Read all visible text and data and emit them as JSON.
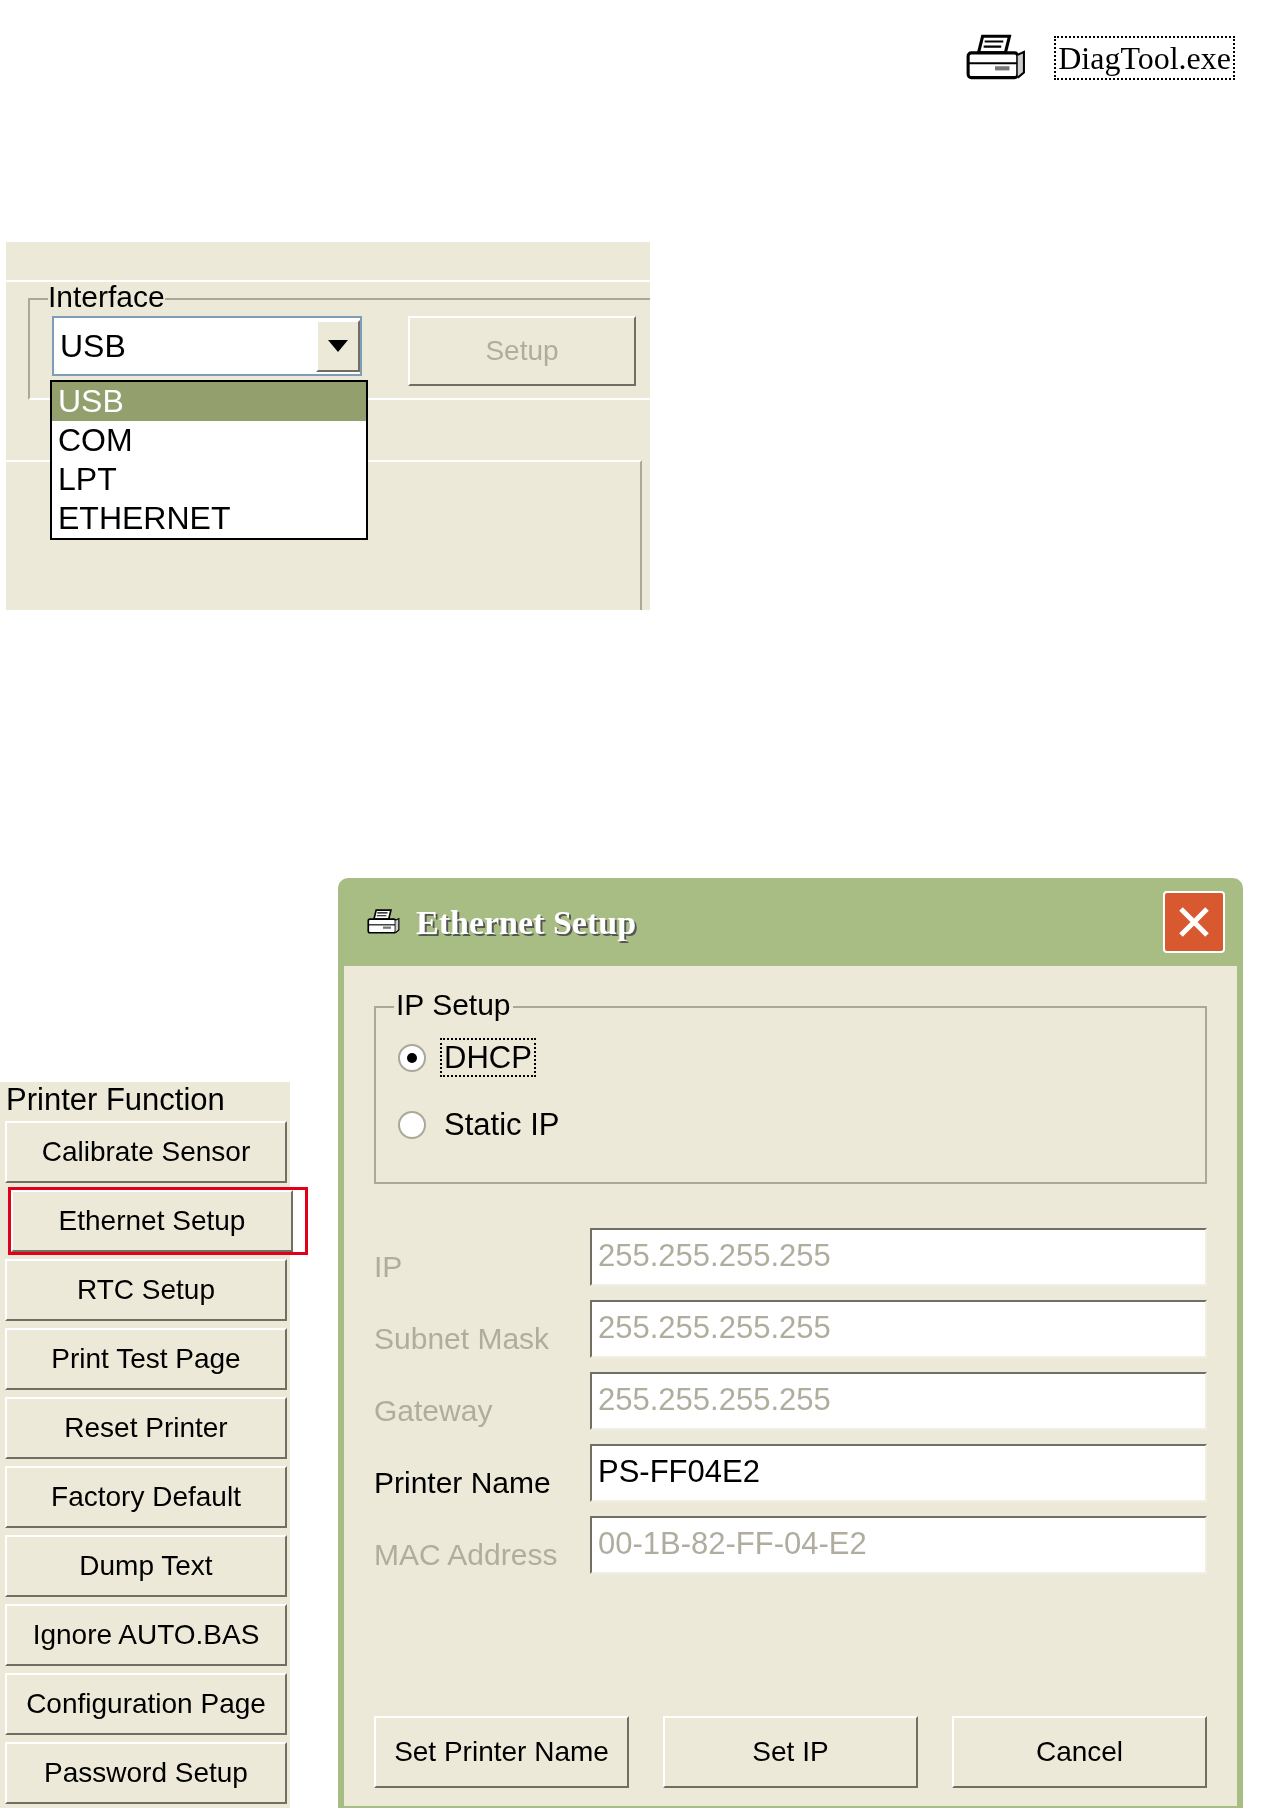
{
  "desktop_icon": {
    "label": "DiagTool.exe",
    "selected": true
  },
  "interface_panel": {
    "group_label": "Interface",
    "combo": {
      "value": "USB",
      "expanded": true
    },
    "setup_button": {
      "label": "Setup",
      "disabled": true
    },
    "options": [
      {
        "label": "USB",
        "selected": true
      },
      {
        "label": "COM",
        "selected": false
      },
      {
        "label": "LPT",
        "selected": false
      },
      {
        "label": "ETHERNET",
        "selected": false
      }
    ]
  },
  "printer_function": {
    "title": "Printer Function",
    "buttons": [
      {
        "label": "Calibrate Sensor",
        "highlighted": false
      },
      {
        "label": "Ethernet Setup",
        "highlighted": true
      },
      {
        "label": "RTC Setup",
        "highlighted": false
      },
      {
        "label": "Print Test Page",
        "highlighted": false
      },
      {
        "label": "Reset Printer",
        "highlighted": false
      },
      {
        "label": "Factory Default",
        "highlighted": false
      },
      {
        "label": "Dump Text",
        "highlighted": false
      },
      {
        "label": "Ignore AUTO.BAS",
        "highlighted": false
      },
      {
        "label": "Configuration Page",
        "highlighted": false
      },
      {
        "label": "Password Setup",
        "highlighted": false
      }
    ]
  },
  "ethernet_dialog": {
    "title": "Ethernet Setup",
    "ip_setup": {
      "label": "IP Setup",
      "options": [
        {
          "label": "DHCP",
          "selected": true
        },
        {
          "label": "Static IP",
          "selected": false
        }
      ]
    },
    "fields": [
      {
        "label": "IP",
        "value": "255.255.255.255",
        "disabled": true
      },
      {
        "label": "Subnet Mask",
        "value": "255.255.255.255",
        "disabled": true
      },
      {
        "label": "Gateway",
        "value": "255.255.255.255",
        "disabled": true
      },
      {
        "label": "Printer Name",
        "value": "PS-FF04E2",
        "disabled": false
      },
      {
        "label": "MAC Address",
        "value": "00-1B-82-FF-04-E2",
        "disabled": true
      }
    ],
    "buttons": [
      "Set Printer Name",
      "Set IP",
      "Cancel"
    ]
  }
}
